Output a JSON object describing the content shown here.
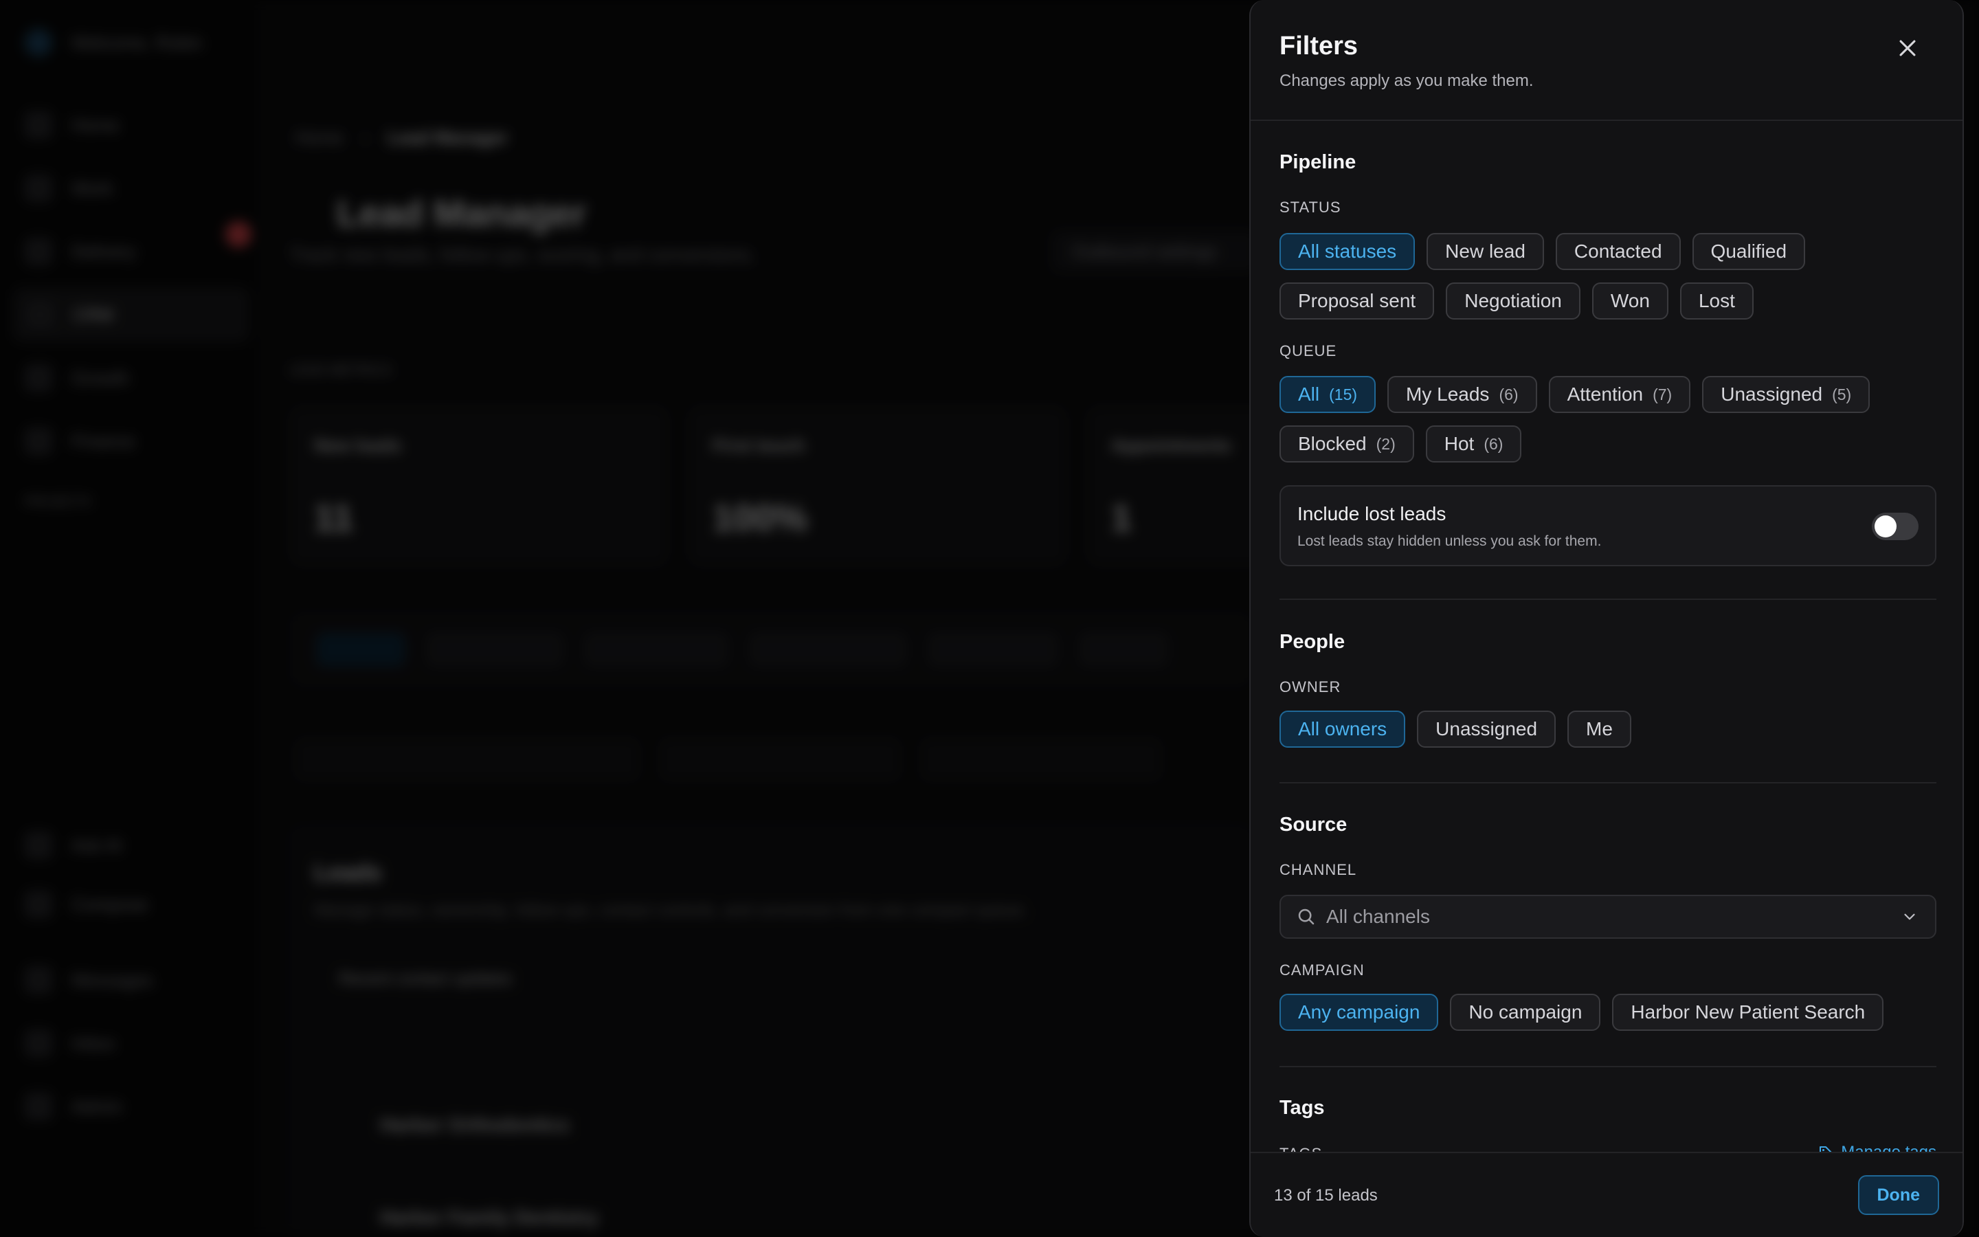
{
  "background": {
    "welcome": "Welcome, Robin",
    "nav": [
      "Home",
      "Work",
      "Delivery",
      "CRM",
      "Growth",
      "Finance"
    ],
    "projects_label": "PROJECTS",
    "bottom_nav": [
      "Ask AI",
      "Compose",
      "Messages",
      "Inbox",
      "Admin"
    ],
    "breadcrumb": [
      "Home",
      "Lead Manager"
    ],
    "page_title": "Lead Manager",
    "page_subtitle": "Track new leads, follow-ups, scoring, and conversions.",
    "outbound_button": "Outbound settings",
    "metrics_label": "LEAD METRICS",
    "metric_cards": [
      {
        "label": "New leads",
        "value": "11"
      },
      {
        "label": "First touch",
        "value": "100%"
      },
      {
        "label": "Appointments",
        "value": "1"
      }
    ],
    "table_title": "Leads",
    "table_subtitle": "Manage status, ownership, follow-ups, contact controls, and conversion from one compact queue.",
    "recent_updates": "Recent contact updates",
    "rows": [
      "Harbor Orthodontics",
      "Harbor Family Dentistry"
    ]
  },
  "panel": {
    "title": "Filters",
    "subtitle": "Changes apply as you make them.",
    "pipeline": {
      "title": "Pipeline",
      "status_label": "STATUS",
      "statuses": [
        {
          "label": "All statuses",
          "selected": true
        },
        {
          "label": "New lead",
          "selected": false
        },
        {
          "label": "Contacted",
          "selected": false
        },
        {
          "label": "Qualified",
          "selected": false
        },
        {
          "label": "Proposal sent",
          "selected": false
        },
        {
          "label": "Negotiation",
          "selected": false
        },
        {
          "label": "Won",
          "selected": false
        },
        {
          "label": "Lost",
          "selected": false
        }
      ],
      "queue_label": "QUEUE",
      "queues": [
        {
          "label": "All",
          "count": "(15)",
          "selected": true
        },
        {
          "label": "My Leads",
          "count": "(6)",
          "selected": false
        },
        {
          "label": "Attention",
          "count": "(7)",
          "selected": false
        },
        {
          "label": "Unassigned",
          "count": "(5)",
          "selected": false
        },
        {
          "label": "Blocked",
          "count": "(2)",
          "selected": false
        },
        {
          "label": "Hot",
          "count": "(6)",
          "selected": false
        }
      ],
      "include_lost": {
        "title": "Include lost leads",
        "description": "Lost leads stay hidden unless you ask for them.",
        "enabled": false
      }
    },
    "people": {
      "title": "People",
      "owner_label": "OWNER",
      "owners": [
        {
          "label": "All owners",
          "selected": true
        },
        {
          "label": "Unassigned",
          "selected": false
        },
        {
          "label": "Me",
          "selected": false
        }
      ]
    },
    "source": {
      "title": "Source",
      "channel_label": "CHANNEL",
      "channel_placeholder": "All channels",
      "campaign_label": "CAMPAIGN",
      "campaigns": [
        {
          "label": "Any campaign",
          "selected": true
        },
        {
          "label": "No campaign",
          "selected": false
        },
        {
          "label": "Harbor New Patient Search",
          "selected": false
        }
      ]
    },
    "tags": {
      "title": "Tags",
      "tags_label": "TAGS",
      "manage_label": "Manage tags"
    },
    "footer": {
      "count": "13 of 15 leads",
      "done_label": "Done"
    }
  },
  "colors": {
    "accent": "#4cb3f0",
    "selected_bg": "#0e2a40",
    "panel_bg": "#121214"
  }
}
